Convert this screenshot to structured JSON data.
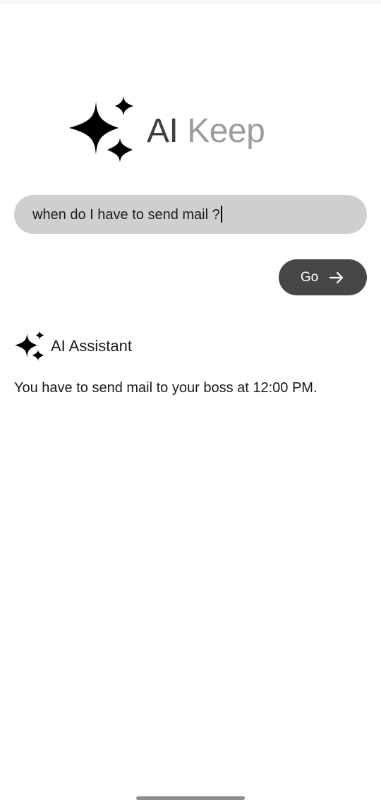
{
  "app": {
    "title_part1": "AI",
    "title_part2": "Keep",
    "logo_icon": "sparkles-icon"
  },
  "search": {
    "value": "when do I have to send mail ?"
  },
  "go_button": {
    "label": "Go",
    "icon": "arrow-right-icon"
  },
  "assistant": {
    "icon": "sparkles-icon",
    "name": "AI Assistant",
    "response": "You have to send mail to your boss at 12:00 PM."
  },
  "colors": {
    "title_dark": "#3d3e40",
    "title_light": "#9b9c9e",
    "search_bg": "#cfcfcf",
    "button_bg": "#454647"
  }
}
